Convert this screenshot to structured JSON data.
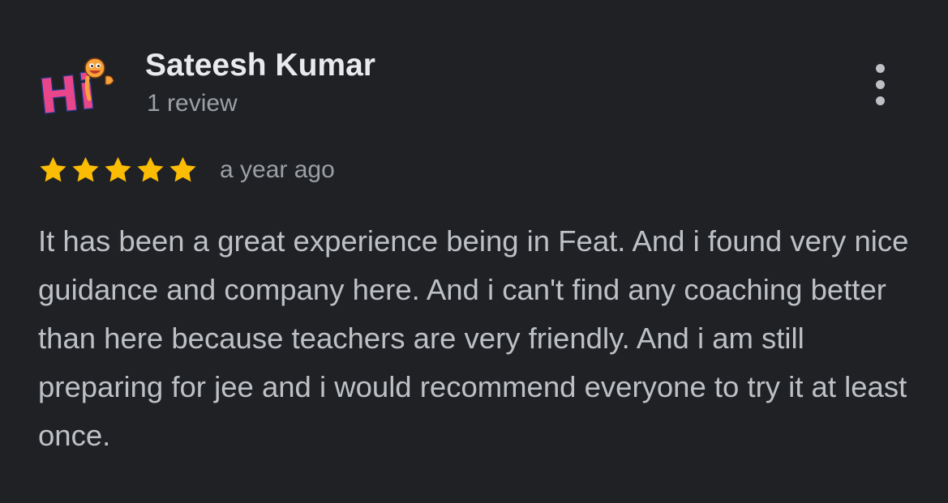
{
  "review": {
    "reviewer_name": "Sateesh Kumar",
    "review_count": "1 review",
    "rating": 5,
    "max_rating": 5,
    "time_ago": "a year ago",
    "text": "It has been a great experience being in Feat. And i found very nice guidance and company here. And i can't find any coaching better than here because teachers are very friendly. And i am still preparing for jee and i would recommend everyone to try it at least once.",
    "avatar": {
      "text": "Hi",
      "icon": "hi-smiley-avatar"
    },
    "more_icon": "more-vert-icon"
  },
  "colors": {
    "background": "#202124",
    "name": "#e8eaed",
    "secondary": "#9aa0a6",
    "body_text": "#bdc1c6",
    "star": "#fbbc04",
    "avatar_pink": "#e8458b",
    "avatar_face": "#f7a23a"
  }
}
